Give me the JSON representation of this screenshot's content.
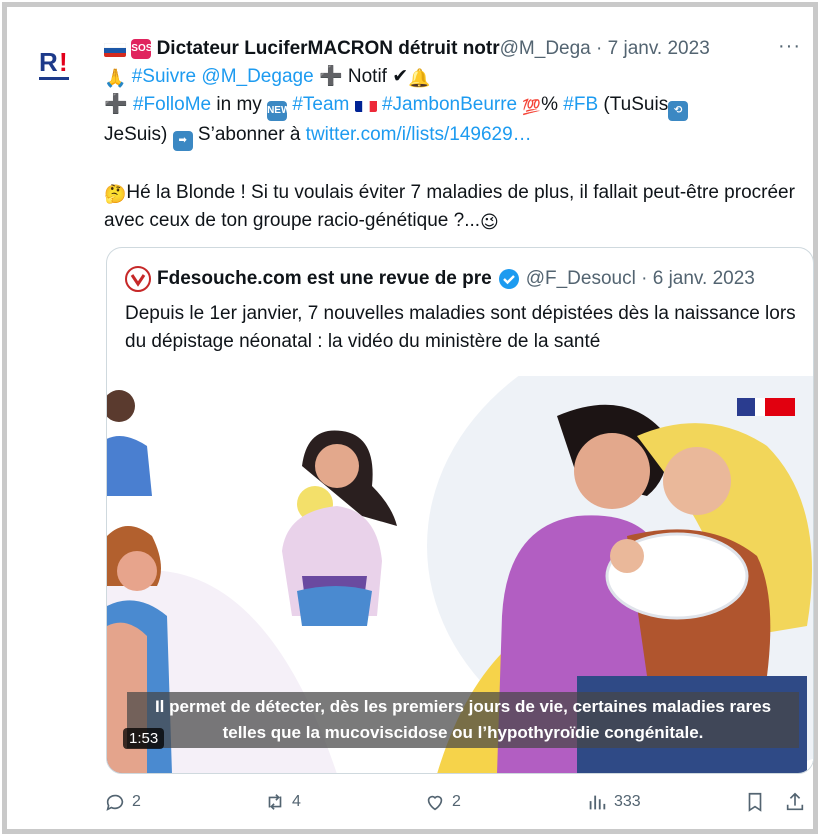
{
  "tweet": {
    "author_name": "Dictateur LuciferMACRON détruit notr",
    "handle": "@M_Dega",
    "separator": "·",
    "date": "7 janv. 2023",
    "more_glyph": "···",
    "text": {
      "l1_suivre": "#Suivre",
      "l1_handle": "@M_Degage",
      "l1_notif": "Notif",
      "l2_in": " in my ",
      "l2_followme": "#FolloMe",
      "l2_team": "#Team",
      "l2_jambon": "#JambonBeurre",
      "l2_pct": "%",
      "l2_fb": "#FB",
      "l2_tusuis": " (TuSuis",
      "l3_jesuis": "JeSuis)",
      "l3_abonner": " S’abonner à ",
      "l3_link": "twitter.com/i/lists/149629…",
      "p2": "Hé la Blonde ! Si tu voulais éviter 7 maladies de plus, il fallait peut-être procréer avec ceux de ton groupe racio-génétique ?..."
    },
    "avatar_text": "R!"
  },
  "quote": {
    "author_name": "Fdesouche.com est une revue de pre",
    "handle": "@F_Desoucl",
    "separator": "·",
    "date": "6 janv. 2023",
    "text": "Depuis le 1er janvier, 7 nouvelles maladies sont dépistées dès la naissance lors du dépistage néonatal : la vidéo du ministère de la santé",
    "video": {
      "caption": "Il permet de détecter, dès les premiers jours de vie, certaines maladies rares telles que la mucoviscidose ou l’hypothyroïdie congénitale.",
      "duration": "1:53"
    }
  },
  "actions": {
    "replies": "2",
    "retweets": "4",
    "likes": "2",
    "views": "333"
  },
  "colors": {
    "link": "#1d9bf0",
    "secondary_text": "#536471",
    "border": "#cfd9de",
    "verified": "#1d9bf0"
  }
}
